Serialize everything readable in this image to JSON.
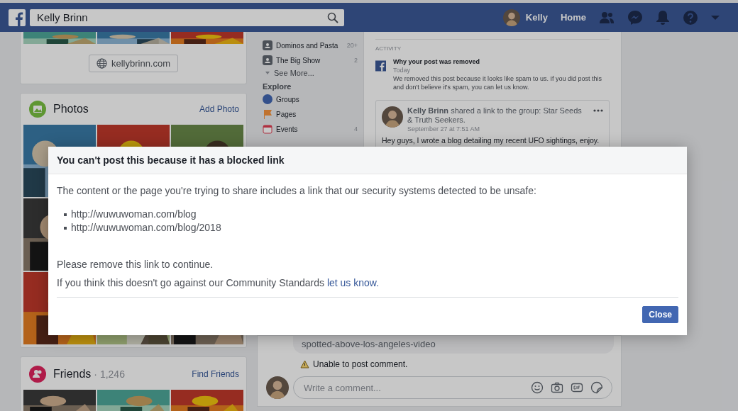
{
  "topbar": {
    "search_value": "Kelly Brinn",
    "user": "Kelly",
    "home": "Home"
  },
  "intro": {
    "website": "kellybrinn.com"
  },
  "photos_card": {
    "title": "Photos",
    "action": "Add Photo"
  },
  "friends_card": {
    "title": "Friends",
    "count": "· 1,246",
    "action": "Find Friends"
  },
  "nav": {
    "groups": [
      {
        "label": "Dominos and Pasta",
        "count": "20+"
      },
      {
        "label": "The Big Show",
        "count": "2"
      }
    ],
    "see_more": "See More...",
    "explore_title": "Explore",
    "explore": [
      {
        "label": "Groups",
        "kind": "groups"
      },
      {
        "label": "Pages",
        "kind": "pages"
      },
      {
        "label": "Events",
        "kind": "events",
        "count": "4"
      }
    ]
  },
  "activity": {
    "heading": "ACTIVITY",
    "title": "Why your post was removed",
    "time": "Today",
    "body": "We removed this post because it looks like spam to us. If you did post this and don't believe it's spam, you can let us know."
  },
  "post": {
    "header": "**Kelly Brinn** shared a link to the group: Star Seeds & Truth Seekers.",
    "time": "September 27 at 7:51 AM",
    "text": "Hey guys, I wrote a blog detailing my recent UFO sightings, enjoy."
  },
  "comment": {
    "link_text": "spotted-above-los-angeles-video",
    "error": "Unable to post comment.",
    "placeholder": "Write a comment..."
  },
  "dialog": {
    "title": "You can't post this because it has a blocked link",
    "message": "The content or the page you're trying to share includes a link that our security systems detected to be unsafe:",
    "links": [
      "http://wuwuwoman.com/blog",
      "http://wuwuwoman.com/blog/2018"
    ],
    "remove_note": "Please remove this link to continue.",
    "appeal": "If you think this doesn't go against our Community Standards",
    "appeal_link": "let us know.",
    "button": "Close"
  }
}
